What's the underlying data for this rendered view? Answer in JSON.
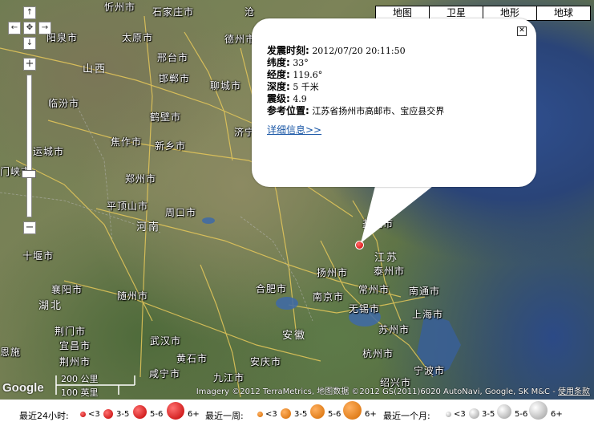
{
  "map_types": [
    "地图",
    "卫星",
    "地形",
    "地球"
  ],
  "nav": {
    "up": "↑",
    "left": "←",
    "center": "✥",
    "right": "→",
    "down": "↓",
    "zoom_in": "+",
    "zoom_out": "−"
  },
  "cities": [
    {
      "id": "xingzhou",
      "label": "忻州市"
    },
    {
      "id": "shijiazhuang",
      "label": "石家庄市"
    },
    {
      "id": "cangzhou",
      "label": "沧"
    },
    {
      "id": "yangquan",
      "label": "阳泉市"
    },
    {
      "id": "taiyuan",
      "label": "太原市"
    },
    {
      "id": "dezhou",
      "label": "德州市"
    },
    {
      "id": "xingtai",
      "label": "邢台市"
    },
    {
      "id": "shanxi",
      "label": "山西"
    },
    {
      "id": "handan",
      "label": "邯郸市"
    },
    {
      "id": "liaocheng",
      "label": "聊城市"
    },
    {
      "id": "linfen",
      "label": "临汾市"
    },
    {
      "id": "hebi",
      "label": "鹤壁市"
    },
    {
      "id": "jiaozuo",
      "label": "焦作市"
    },
    {
      "id": "xinxiang",
      "label": "新乡市"
    },
    {
      "id": "jining",
      "label": "济宁"
    },
    {
      "id": "yuncheng",
      "label": "运城市"
    },
    {
      "id": "zhengzhou",
      "label": "郑州市"
    },
    {
      "id": "sanmenxia",
      "label": "门峡市"
    },
    {
      "id": "pingdingshan",
      "label": "平顶山市"
    },
    {
      "id": "zhoukou",
      "label": "周口市"
    },
    {
      "id": "henan",
      "label": "河南"
    },
    {
      "id": "yancheng",
      "label": "盐城市"
    },
    {
      "id": "jiangsu",
      "label": "江苏"
    },
    {
      "id": "shiyan",
      "label": "十堰市"
    },
    {
      "id": "yangzhou",
      "label": "扬州市"
    },
    {
      "id": "taizhou",
      "label": "泰州市"
    },
    {
      "id": "xiangyang",
      "label": "襄阳市"
    },
    {
      "id": "suizhou",
      "label": "随州市"
    },
    {
      "id": "hefei",
      "label": "合肥市"
    },
    {
      "id": "nanjing",
      "label": "南京市"
    },
    {
      "id": "changzhou",
      "label": "常州市"
    },
    {
      "id": "nantong",
      "label": "南通市"
    },
    {
      "id": "hubei",
      "label": "湖北"
    },
    {
      "id": "wuxi",
      "label": "无锡市"
    },
    {
      "id": "shanghai",
      "label": "上海市"
    },
    {
      "id": "anhui",
      "label": "安徽"
    },
    {
      "id": "suzhou",
      "label": "苏州市"
    },
    {
      "id": "jingmen",
      "label": "荆门市"
    },
    {
      "id": "yichang",
      "label": "宜昌市"
    },
    {
      "id": "wuhan",
      "label": "武汉市"
    },
    {
      "id": "jingzhou",
      "label": "荆州市"
    },
    {
      "id": "huanggang",
      "label": "黄石市"
    },
    {
      "id": "anqing",
      "label": "安庆市"
    },
    {
      "id": "hangzhou",
      "label": "杭州市"
    },
    {
      "id": "xianning",
      "label": "咸宁市"
    },
    {
      "id": "jiujiang",
      "label": "九江市"
    },
    {
      "id": "ningbo",
      "label": "宁波市"
    },
    {
      "id": "shaoxing",
      "label": "绍兴市"
    },
    {
      "id": "enshi",
      "label": "恩施"
    }
  ],
  "info_window": {
    "time_label": "发震时刻:",
    "time_value": "2012/07/20 20:11:50",
    "lat_label": "纬度:",
    "lat_value": "33°",
    "lon_label": "经度:",
    "lon_value": "119.6°",
    "depth_label": "深度:",
    "depth_value": "5 千米",
    "mag_label": "震级:",
    "mag_value": "4.9",
    "loc_label": "参考位置:",
    "loc_value": "江苏省扬州市高邮市、宝应县交界",
    "detail_link": "详细信息>>",
    "close": "✕"
  },
  "scale": {
    "km": "200 公里",
    "mi": "100 英里"
  },
  "google_logo": "Google",
  "attribution": {
    "text": "Imagery ©2012 TerraMetrics, 地图数据 ©2012 GS(2011)6020 AutoNavi, Google, SK M&C - ",
    "terms": "使用条款"
  },
  "legend": {
    "groups": [
      {
        "label": "最近24小时:",
        "color": "red",
        "levels": [
          "<3",
          "3-5",
          "5-6",
          "6+"
        ]
      },
      {
        "label": "最近一周:",
        "color": "orange",
        "levels": [
          "<3",
          "3-5",
          "5-6",
          "6+"
        ]
      },
      {
        "label": "最近一个月:",
        "color": "white",
        "levels": [
          "<3",
          "3-5",
          "5-6",
          "6+"
        ]
      }
    ],
    "colors": {
      "red": "#d40000",
      "orange": "#e87b10",
      "white": "#d8d8d8"
    }
  }
}
